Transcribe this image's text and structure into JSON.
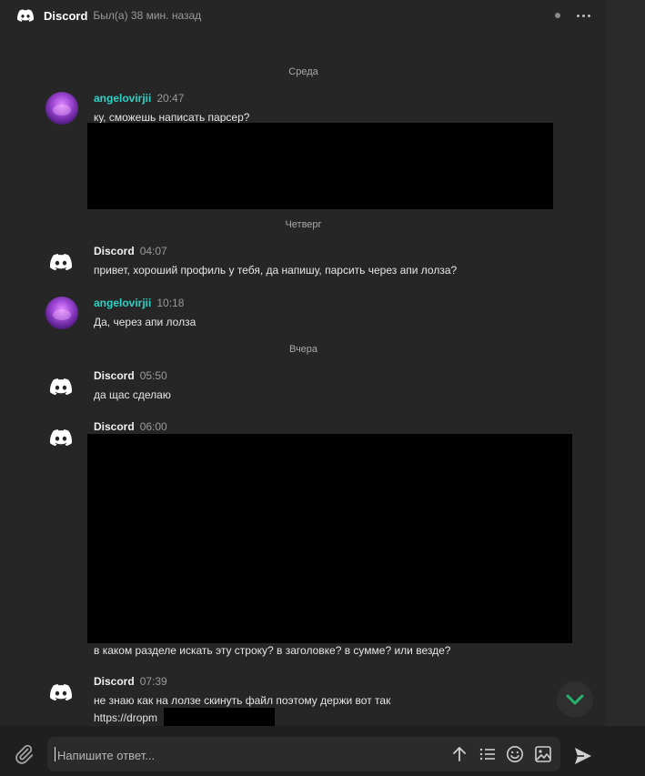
{
  "header": {
    "title": "Discord",
    "status": "Был(а) 38 мин. назад"
  },
  "dates": {
    "d1": "Среда",
    "d2": "Четверг",
    "d3": "Вчера"
  },
  "messages": [
    {
      "author": "angelovirjii",
      "time": "20:47",
      "text": "ку, сможешь написать парсер?"
    },
    {
      "author": "Discord",
      "time": "04:07",
      "text": "привет, хороший профиль у тебя, да напишу, парсить через апи лолза?"
    },
    {
      "author": "angelovirjii",
      "time": "10:18",
      "text": "Да, через апи лолза"
    },
    {
      "author": "Discord",
      "time": "05:50",
      "text": "да щас сделаю"
    },
    {
      "author": "Discord",
      "time": "06:00",
      "text": "в каком разделе искать эту строку? в заголовке? в сумме? или везде?"
    },
    {
      "author": "Discord",
      "time": "07:39",
      "text": "не знаю как на лолзе скинуть файл поэтому держи вот так",
      "link": "https://dropm"
    }
  ],
  "composer": {
    "placeholder": "Напишите ответ..."
  },
  "colors": {
    "user_name": "#2bd2c6",
    "link": "#3fc06a",
    "scroll_check": "#25b36a"
  },
  "icons": [
    "discord-logo-icon",
    "more-icon",
    "attach-icon",
    "arrow-up-icon",
    "list-icon",
    "emoji-icon",
    "image-icon",
    "send-icon",
    "chevron-down-icon"
  ]
}
